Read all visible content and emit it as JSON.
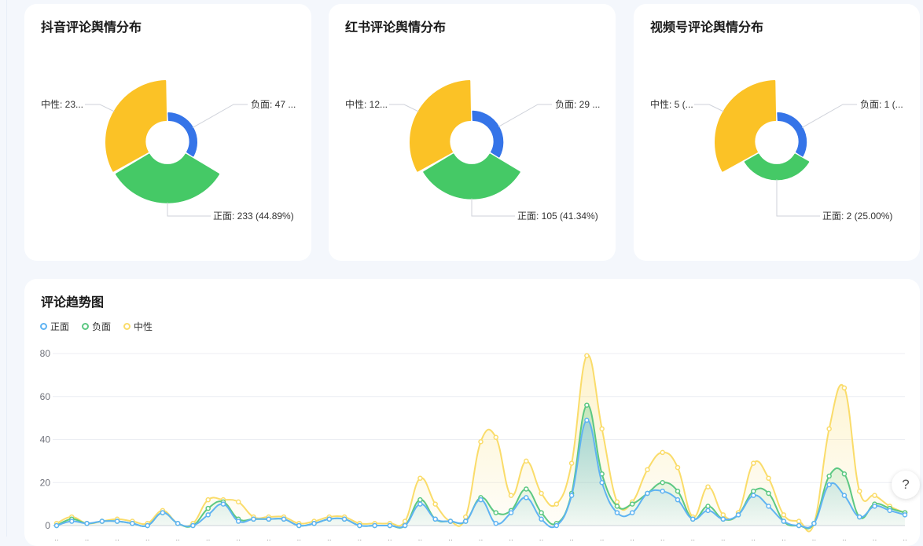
{
  "pies": [
    {
      "title": "抖音评论舆情分布",
      "slices": [
        {
          "name": "负面",
          "value": 47,
          "label": "负面: 47 ..."
        },
        {
          "name": "正面",
          "value": 233,
          "label": "正面: 233 (44.89%)"
        },
        {
          "name": "中性",
          "value": 239,
          "label": "中性: 23..."
        }
      ]
    },
    {
      "title": "红书评论舆情分布",
      "slices": [
        {
          "name": "负面",
          "value": 29,
          "label": "负面: 29 ..."
        },
        {
          "name": "正面",
          "value": 105,
          "label": "正面: 105 (41.34%)"
        },
        {
          "name": "中性",
          "value": 120,
          "label": "中性: 12..."
        }
      ]
    },
    {
      "title": "视频号评论舆情分布",
      "slices": [
        {
          "name": "负面",
          "value": 1,
          "label": "负面: 1 (..."
        },
        {
          "name": "正面",
          "value": 2,
          "label": "正面: 2 (25.00%)"
        },
        {
          "name": "中性",
          "value": 5,
          "label": "中性: 5 (..."
        }
      ]
    }
  ],
  "pie_colors": {
    "负面": "#3574e8",
    "正面": "#45c966",
    "中性": "#fbc226"
  },
  "help_label": "?",
  "chart_data": {
    "type": "line",
    "title": "评论趋势图",
    "ylim": [
      0,
      80
    ],
    "yticks": [
      "0",
      "20",
      "40",
      "60",
      "80"
    ],
    "legend_position": "top-left",
    "series": [
      {
        "name": "正面",
        "color": "#5fb3f2",
        "values": [
          0,
          2,
          1,
          2,
          2,
          1,
          0,
          6,
          1,
          0,
          5,
          10,
          2,
          3,
          3,
          3,
          0,
          1,
          3,
          3,
          0,
          0,
          0,
          0,
          10,
          3,
          2,
          2,
          12,
          1,
          6,
          13,
          3,
          0,
          14,
          49,
          20,
          6,
          6,
          15,
          16,
          12,
          3,
          7,
          3,
          5,
          14,
          9,
          2,
          0,
          1,
          19,
          14,
          4,
          9,
          7,
          5
        ]
      },
      {
        "name": "负面",
        "color": "#5cc882",
        "values": [
          0,
          3,
          1,
          2,
          2,
          1,
          0,
          6,
          1,
          0,
          8,
          11,
          3,
          3,
          3,
          3,
          0,
          1,
          3,
          3,
          0,
          0,
          0,
          0,
          12,
          3,
          2,
          2,
          13,
          6,
          7,
          17,
          6,
          1,
          15,
          56,
          24,
          9,
          10,
          15,
          20,
          16,
          3,
          9,
          3,
          5,
          16,
          15,
          2,
          0,
          1,
          23,
          24,
          4,
          10,
          8,
          6
        ]
      },
      {
        "name": "中性",
        "color": "#fadc6a",
        "values": [
          1,
          4,
          1,
          2,
          3,
          2,
          1,
          7,
          1,
          1,
          12,
          12,
          11,
          4,
          4,
          4,
          1,
          2,
          4,
          4,
          1,
          1,
          1,
          2,
          22,
          10,
          2,
          4,
          39,
          41,
          14,
          30,
          15,
          10,
          29,
          79,
          45,
          11,
          11,
          26,
          34,
          27,
          4,
          18,
          5,
          6,
          29,
          22,
          5,
          2,
          1,
          45,
          64,
          16,
          14,
          9,
          6
        ]
      }
    ]
  }
}
